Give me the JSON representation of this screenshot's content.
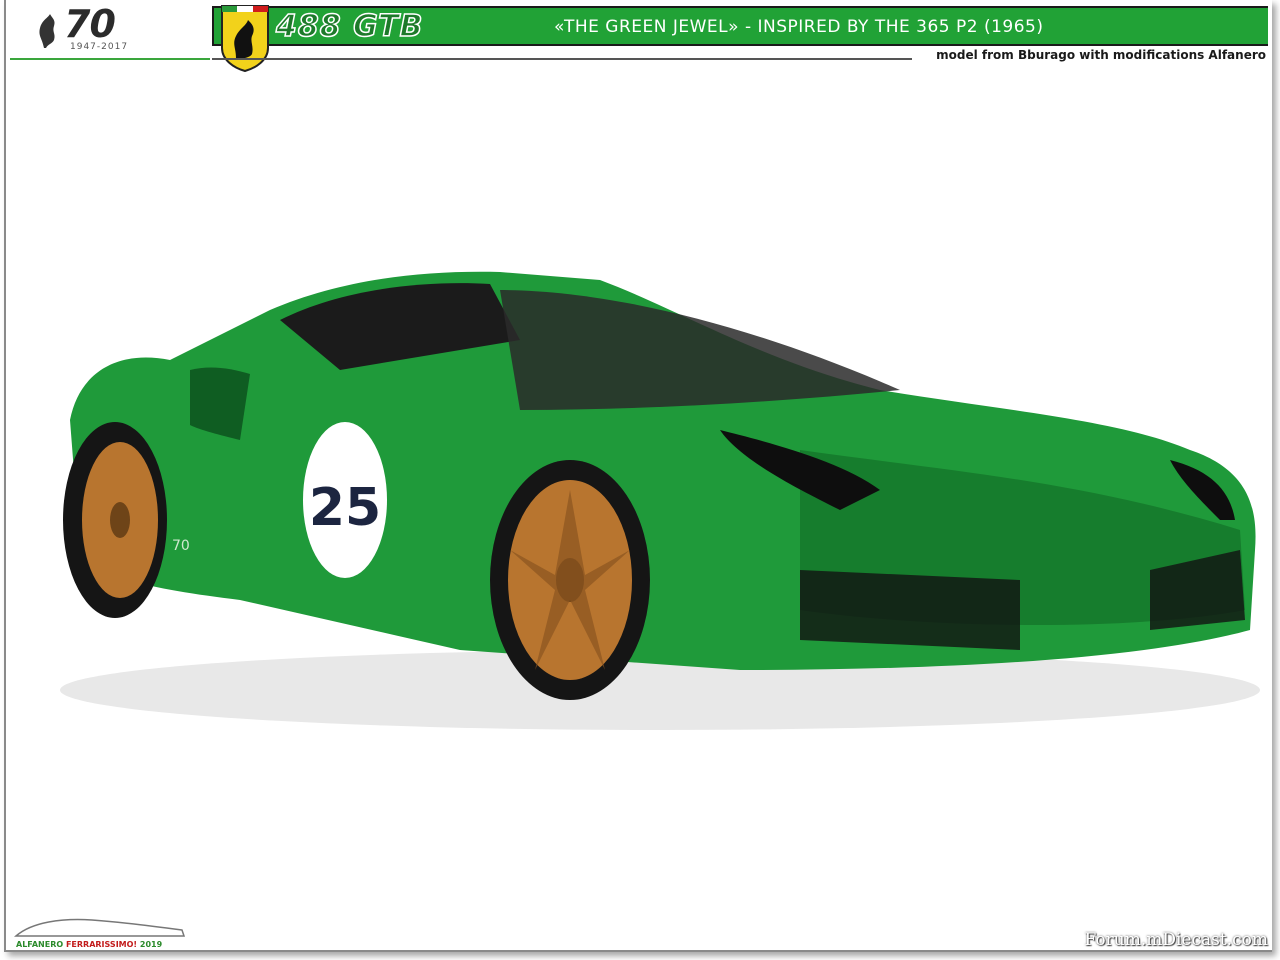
{
  "header": {
    "anniversary_number": "70",
    "anniversary_years": "1947-2017",
    "model_name": "488 GTB",
    "subtitle": "«THE GREEN JEWEL»  -  INSPIRED BY THE 365 P2  (1965)",
    "caption": "model from Bburago with modifications Alfanero"
  },
  "car": {
    "race_number": "25",
    "side_badge": "70",
    "body_color": "#1f9a3a",
    "wheel_color": "#b8752f"
  },
  "footer": {
    "logo_text_green": "ALFANERO",
    "logo_text_red": "FERRARISSIMO!",
    "logo_year": "2019",
    "watermark": "Forum.mDiecast.com"
  },
  "colors": {
    "header_green": "#21a236",
    "accent_line": "#3aa63c",
    "shield_yellow": "#f2d21b"
  }
}
